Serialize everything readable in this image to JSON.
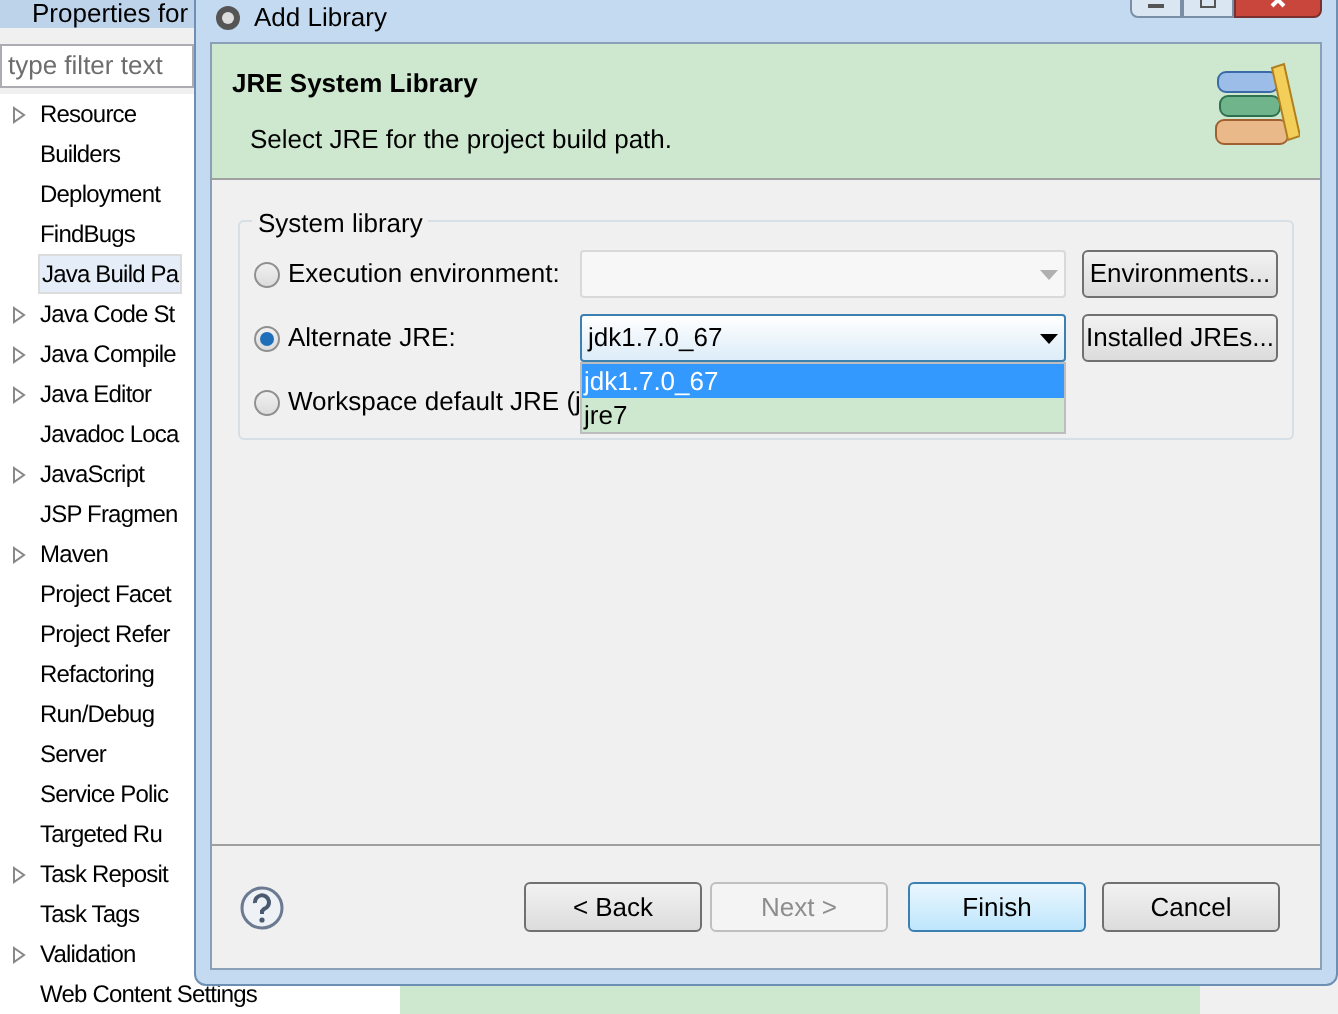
{
  "background_window": {
    "title": "Properties for",
    "filter": {
      "placeholder": "type filter text"
    },
    "items": [
      {
        "label": "Resource",
        "expandable": true,
        "selected": false
      },
      {
        "label": "Builders",
        "expandable": false,
        "selected": false
      },
      {
        "label": "Deployment",
        "expandable": false,
        "selected": false
      },
      {
        "label": "FindBugs",
        "expandable": false,
        "selected": false
      },
      {
        "label": "Java Build Pa",
        "expandable": false,
        "selected": true
      },
      {
        "label": "Java Code St",
        "expandable": true,
        "selected": false
      },
      {
        "label": "Java Compile",
        "expandable": true,
        "selected": false
      },
      {
        "label": "Java Editor",
        "expandable": true,
        "selected": false
      },
      {
        "label": "Javadoc Loca",
        "expandable": false,
        "selected": false
      },
      {
        "label": "JavaScript",
        "expandable": true,
        "selected": false
      },
      {
        "label": "JSP Fragmen",
        "expandable": false,
        "selected": false
      },
      {
        "label": "Maven",
        "expandable": true,
        "selected": false
      },
      {
        "label": "Project Facet",
        "expandable": false,
        "selected": false
      },
      {
        "label": "Project Refer",
        "expandable": false,
        "selected": false
      },
      {
        "label": "Refactoring",
        "expandable": false,
        "selected": false
      },
      {
        "label": "Run/Debug",
        "expandable": false,
        "selected": false
      },
      {
        "label": "Server",
        "expandable": false,
        "selected": false
      },
      {
        "label": "Service Polic",
        "expandable": false,
        "selected": false
      },
      {
        "label": "Targeted Ru",
        "expandable": false,
        "selected": false
      },
      {
        "label": "Task Reposit",
        "expandable": true,
        "selected": false
      },
      {
        "label": "Task Tags",
        "expandable": false,
        "selected": false
      },
      {
        "label": "Validation",
        "expandable": true,
        "selected": false
      },
      {
        "label": "Web Content Settings",
        "expandable": false,
        "selected": false
      }
    ]
  },
  "dialog": {
    "title": "Add Library",
    "header": {
      "title": "JRE System Library",
      "description": "Select JRE for the project build path."
    },
    "group": {
      "legend": "System library",
      "options": [
        {
          "label": "Execution environment:",
          "selected": false,
          "kind": "combo",
          "disabled": true,
          "button": "Environments..."
        },
        {
          "label": "Alternate JRE:",
          "selected": true,
          "kind": "combo",
          "value": "jdk1.7.0_67",
          "disabled": false,
          "button": "Installed JREs...",
          "dropdown": [
            {
              "label": "jdk1.7.0_67",
              "selected": true
            },
            {
              "label": "jre7",
              "selected": false
            }
          ]
        },
        {
          "label": "Workspace default JRE (j",
          "selected": false,
          "kind": "plain"
        }
      ]
    },
    "buttons": [
      {
        "label": "< Back",
        "disabled": false,
        "default": false
      },
      {
        "label": "Next >",
        "disabled": true,
        "default": false
      },
      {
        "label": "Finish",
        "disabled": false,
        "default": true
      },
      {
        "label": "Cancel",
        "disabled": false,
        "default": false
      }
    ]
  }
}
